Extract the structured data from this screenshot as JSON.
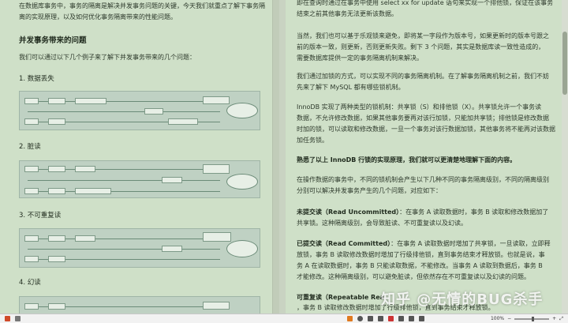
{
  "left_page": {
    "intro_line1": "在数据库事务中，事务的隔离是解决并发事务问题的关键，今天我们就重点了解下事务隔",
    "intro_line2": "离的实现原理，以及如何优化事务隔离带来的性能问题。",
    "heading_concurrency": "并发事务带来的问题",
    "concurrency_intro": "我们可以通过以下几个例子来了解下并发事务带来的几个问题：",
    "section1": "1. 数据丢失",
    "section2": "2. 脏读",
    "section3": "3. 不可重复读",
    "section4": "4. 幻读"
  },
  "right_page": {
    "p0_line1": "即在查询时通过在事务中使用 select xx for update 语句来实现一个排他锁，保证在该事务",
    "p0_line2": "结束之前其他事务无法更新该数据。",
    "p1_line1": "当然，我们也可以基于乐观锁来避免，即将某一字段作为版本号，如果更新时的版本号跟之",
    "p1_line2": "前的版本一致，则更新，否则更新失败。剩下 3 个问题，其实是数据库读一致性造成的，",
    "p1_line3": "需要数据库提供一定的事务隔离机制来解决。",
    "p2_line1": "我们通过加锁的方式，可以实现不同的事务隔离机制。在了解事务隔离机制之前，我们不妨",
    "p2_line2": "先来了解下 MySQL 都有哪些锁机制。",
    "p3_line1": "InnoDB 实现了两种类型的锁机制：共享锁（S）和排他锁（X）。共享锁允许一个事务读",
    "p3_line2": "数据，不允许修改数据，如果其他事务要再对该行加锁，只能加共享锁；排他锁是修改数据",
    "p3_line3": "时加的锁，可以读取和修改数据，一旦一个事务对该行数据加锁，其他事务将不能再对该数据",
    "p3_line4": "加任务锁。",
    "p4_bold": "熟悉了以上 InnoDB 行锁的实现原理，我们就可以更清楚地理解下面的内容。",
    "p5_line1": "在操作数据的事务中，不同的锁机制会产生以下几种不同的事务隔离级别，不同的隔离级别",
    "p5_line2": "分别可以解决并发事务产生的几个问题，对应如下：",
    "p6_title": "未提交读（Read Uncommitted）",
    "p6_line1": "：在事务 A 读取数据时，事务 B 读取和修改数据加了",
    "p6_line2": "共享锁。这种隔离级别，会导致脏读、不可重复读以及幻读。",
    "p7_title": "已提交读（Read Committed）",
    "p7_line1": "：在事务 A 读取数据时增加了共享锁，一旦读取，立即释",
    "p7_line2": "放锁，事务 B 读取修改数据时增加了行级排他锁，直到事务结束才释放锁。也就是说，事",
    "p7_line3": "务 A 在读取数据时，事务 B 只能读取数据，不能修改。当事务 A 读取到数据后，事务 B",
    "p7_line4": "才能修改。这种隔离级别，可以避免脏读，但依然存在不可重复读以及幻读的问题。",
    "p8_title": "可重复读（Repeatable Rea",
    "p8_line1": "，事务 B 读取修改数据时增加了行级排他锁，直到事务结束才释放锁。"
  },
  "watermark": "知乎 @无情的BUG杀手",
  "statusbar": {
    "page_indicator": "",
    "zoom_level": "100%"
  }
}
